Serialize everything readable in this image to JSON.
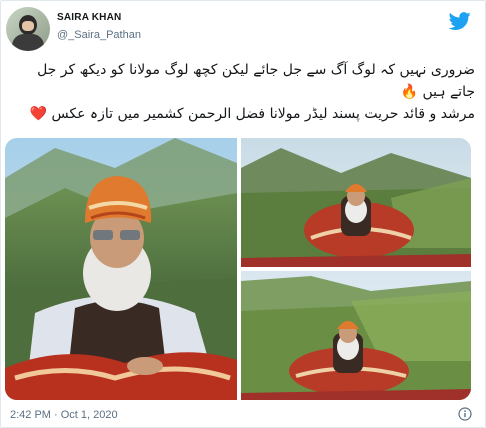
{
  "user": {
    "display_name": "SAIRA KHAN",
    "handle": "@_Saira_Pathan"
  },
  "tweet": {
    "line1": "ضروری نہیں کہ لوگ آگ سے جل جائے لیکن کچھ لوگ مولانا کو دیکھ کر جل",
    "line2": "جاتے ہیں 🔥",
    "line3": "مرشد و قائد حریت پسند لیڈر مولانا فضل الرحمن کشمیر میں تازہ عکس ❤️",
    "timestamp": "2:42 PM · Oct 1, 2020"
  },
  "media": {
    "count": 3
  },
  "icons": {
    "brand": "twitter-bird-icon",
    "info": "info-icon"
  },
  "colors": {
    "brand_blue": "#1da1f2",
    "text_secondary": "#5b7083",
    "heart_red": "#e0245e",
    "fire_orange": "#f4900c"
  }
}
